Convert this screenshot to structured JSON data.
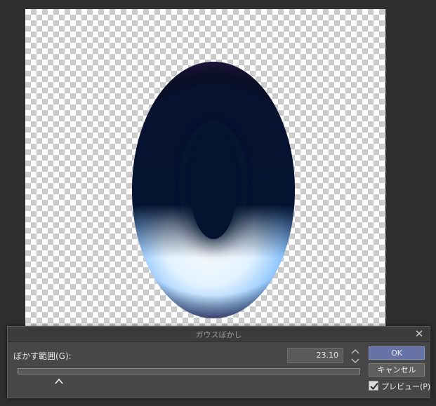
{
  "dialog": {
    "title": "ガウスぼかし",
    "param_label": "ぼかす範囲(G):",
    "value": "23.10",
    "slider_level_percent": 12,
    "ok_label": "OK",
    "cancel_label": "キャンセル",
    "preview_label": "プレビュー(P)",
    "preview_checked": true
  },
  "icons": {
    "close": "close-icon",
    "spinner": "up-down-arrows-icon",
    "checkmark": "checkmark-icon"
  },
  "colors": {
    "ok_button": "#6773a6",
    "shape_dark": "#051230",
    "shape_glow": "#8fc6ff"
  }
}
